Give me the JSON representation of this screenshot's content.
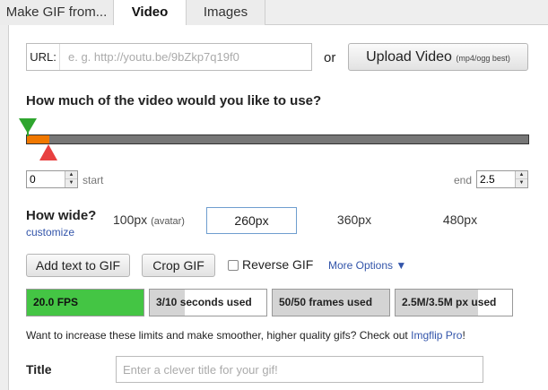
{
  "tabs": [
    {
      "label": "Make GIF from...",
      "active": false
    },
    {
      "label": "Video",
      "active": true
    },
    {
      "label": "Images",
      "active": false
    }
  ],
  "url": {
    "label": "URL:",
    "placeholder": "e. g. http://youtu.be/9bZkp7q19f0",
    "value": ""
  },
  "or_text": "or",
  "upload_button": {
    "label": "Upload Video",
    "hint": "(mp4/ogg best)"
  },
  "range": {
    "question": "How much of the video would you like to use?",
    "duration": 2.5,
    "selected_start": 0,
    "selected_end": 2.5,
    "start_value": "0",
    "start_label": "start",
    "end_value": "2.5",
    "end_label": "end"
  },
  "width": {
    "label": "How wide?",
    "customize_label": "customize",
    "options": [
      {
        "label": "100px",
        "note": "(avatar)",
        "selected": false
      },
      {
        "label": "260px",
        "note": "",
        "selected": true
      },
      {
        "label": "360px",
        "note": "",
        "selected": false
      },
      {
        "label": "480px",
        "note": "",
        "selected": false
      }
    ]
  },
  "actions": {
    "add_text_label": "Add text to GIF",
    "crop_label": "Crop GIF",
    "reverse_label": "Reverse GIF",
    "reverse_checked": false,
    "more_options_label": "More Options ▼"
  },
  "meters": [
    {
      "label": "20.0 FPS",
      "fill": 1.0,
      "color": "#44c544"
    },
    {
      "label": "3/10 seconds used",
      "fill": 0.3,
      "color": "#d4d4d4"
    },
    {
      "label": "50/50 frames used",
      "fill": 1.0,
      "color": "#d4d4d4"
    },
    {
      "label": "2.5M/3.5M px used",
      "fill": 0.71,
      "color": "#d4d4d4"
    }
  ],
  "limits": {
    "text": "Want to increase these limits and make smoother, higher quality gifs? Check out ",
    "link_label": "Imgflip Pro",
    "suffix": "!"
  },
  "title_field": {
    "label": "Title",
    "placeholder": "Enter a clever title for your gif!",
    "value": ""
  }
}
